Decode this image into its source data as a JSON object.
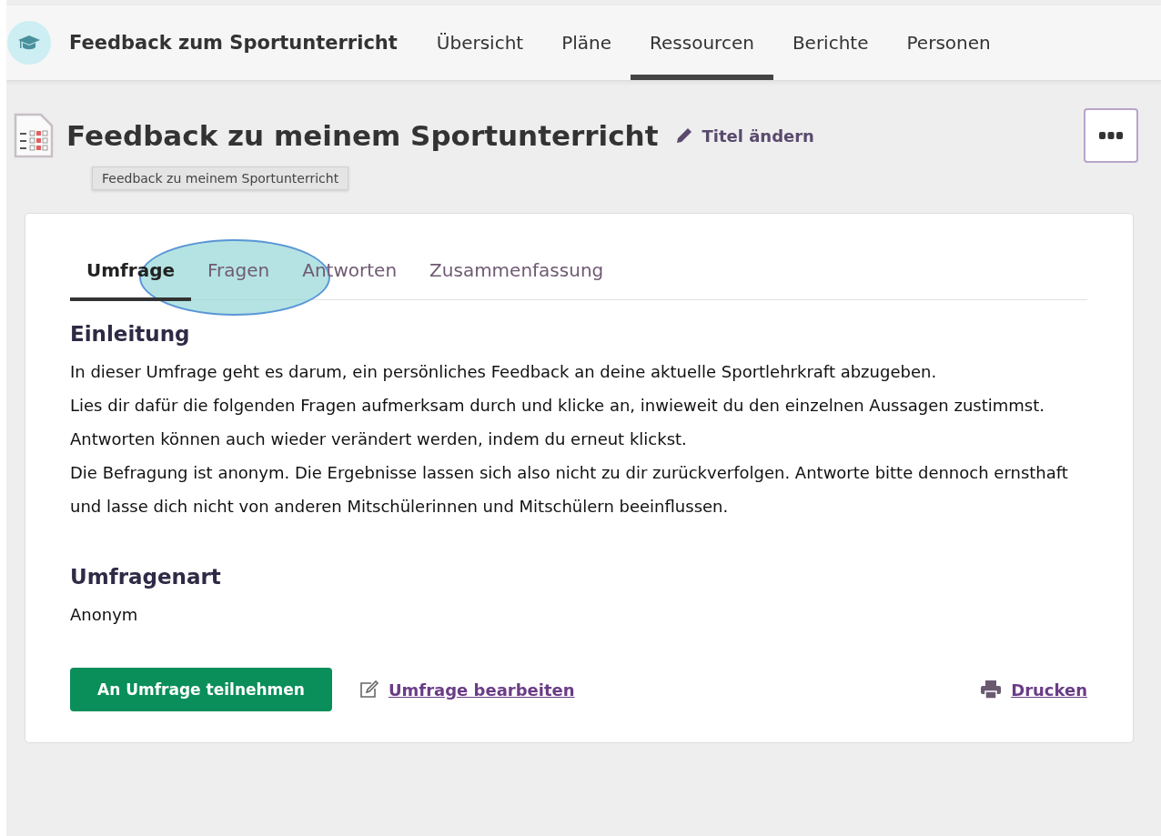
{
  "app": {
    "title": "Feedback zum Sportunterricht"
  },
  "nav": [
    {
      "label": "Übersicht",
      "selected": false
    },
    {
      "label": "Pläne",
      "selected": false
    },
    {
      "label": "Ressourcen",
      "selected": true
    },
    {
      "label": "Berichte",
      "selected": false
    },
    {
      "label": "Personen",
      "selected": false
    }
  ],
  "page": {
    "title": "Feedback zu meinem Sportunterricht",
    "rename": "Titel ändern",
    "tooltip": "Feedback zu meinem Sportunterricht"
  },
  "tabs": [
    {
      "label": "Umfrage",
      "selected": true
    },
    {
      "label": "Fragen",
      "selected": false
    },
    {
      "label": "Antworten",
      "selected": false
    },
    {
      "label": "Zusammenfassung",
      "selected": false
    }
  ],
  "sections": [
    {
      "heading": "Einleitung",
      "paragraphs": [
        "In dieser Umfrage geht es darum, ein persönliches Feedback an deine aktuelle Sportlehrkraft abzugeben.",
        "Lies dir dafür die folgenden Fragen aufmerksam durch und klicke an, inwieweit du den einzelnen Aussagen zustimmst. Antworten können auch wieder verändert werden, indem du erneut klickst.",
        "Die Befragung ist anonym. Die Ergebnisse lassen sich also nicht zu dir zurückverfolgen. Antworte bitte dennoch ernsthaft und lasse dich nicht von anderen Mitschülerinnen und Mitschülern beeinflussen."
      ]
    },
    {
      "heading": "Umfragenart",
      "paragraphs": [
        "Anonym"
      ]
    }
  ],
  "actions": {
    "primary": "An Umfrage teilnehmen",
    "edit": "Umfrage bearbeiten",
    "print": "Drucken"
  }
}
